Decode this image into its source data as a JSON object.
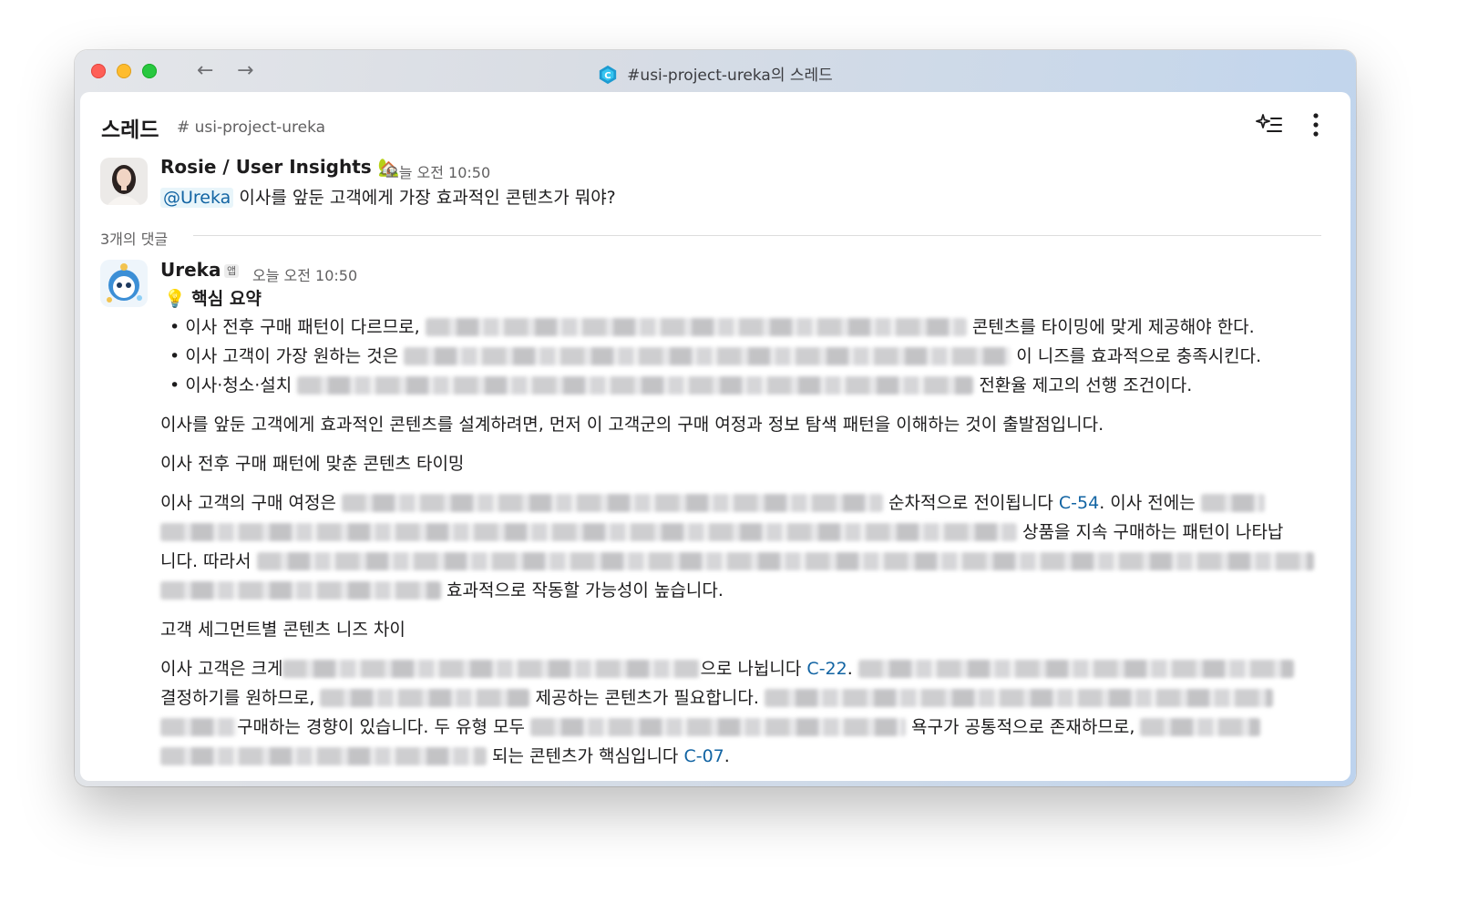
{
  "window": {
    "title": "#usi-project-ureka의 스레드",
    "app_icon": "slack-diamond-icon"
  },
  "header": {
    "title": "스레드",
    "channel": "# usi-project-ureka",
    "icons": [
      "sparkle-list-icon",
      "more-vertical-icon"
    ]
  },
  "colors": {
    "link": "#1264a3",
    "mention_bg": "#e8f5fa",
    "text": "#1d1c1d",
    "muted": "#616061"
  },
  "parent_message": {
    "author": "Rosie / User Insights",
    "author_emoji": "🏡",
    "time": "오늘 오전 10:50",
    "mention": "@Ureka",
    "text": "이사를 앞둔 고객에게 가장 효과적인 콘텐츠가 뭐야?"
  },
  "reply_count": "3개의 댓글",
  "reply": {
    "author": "Ureka",
    "app_badge": "앱",
    "time": "오늘 오전 10:50",
    "summary_icon": "💡",
    "summary_title": "핵심 요약",
    "bullets": [
      {
        "start": "이사 전후 구매 패턴이 다르므로,",
        "end": "콘텐츠를 타이밍에 맞게 제공해야 한다."
      },
      {
        "start": "이사 고객이 가장 원하는 것은",
        "end": "이 니즈를 효과적으로 충족시킨다."
      },
      {
        "start": "이사·청소·설치",
        "end": "전환율 제고의 선행 조건이다."
      }
    ],
    "intro": "이사를 앞둔 고객에게 효과적인 콘텐츠를 설계하려면, 먼저 이 고객군의 구매 여정과 정보 탐색 패턴을 이해하는 것이 출발점입니다.",
    "section1_heading": "이사 전후 구매 패턴에 맞춘 콘텐츠 타이밍",
    "section1_lines": [
      {
        "a": "이사 고객의 구매 여정은",
        "b": "순차적으로 전이됩니다",
        "link": "C-54",
        "c": ". 이사 전에는"
      },
      {
        "a": "상품을 지속 구매하는 패턴이 나타납"
      },
      {
        "a": "니다. 따라서"
      },
      {
        "a": "효과적으로 작동할 가능성이 높습니다."
      }
    ],
    "section2_heading": "고객 세그먼트별 콘텐츠 니즈 차이",
    "section2_lines": [
      {
        "a": "이사 고객은 크게",
        "b": "으로 나뉩니다",
        "link": "C-22",
        "c": "."
      },
      {
        "a": "결정하기를 원하므로,",
        "b": "제공하는 콘텐츠가 필요합니다."
      },
      {
        "a": "구매하는 경향이 있습니다. 두 유형 모두",
        "b": "욕구가 공통적으로 존재하므로,"
      },
      {
        "a": "되는 콘텐츠가 핵심입니다",
        "link": "C-07",
        "c": "."
      }
    ]
  }
}
